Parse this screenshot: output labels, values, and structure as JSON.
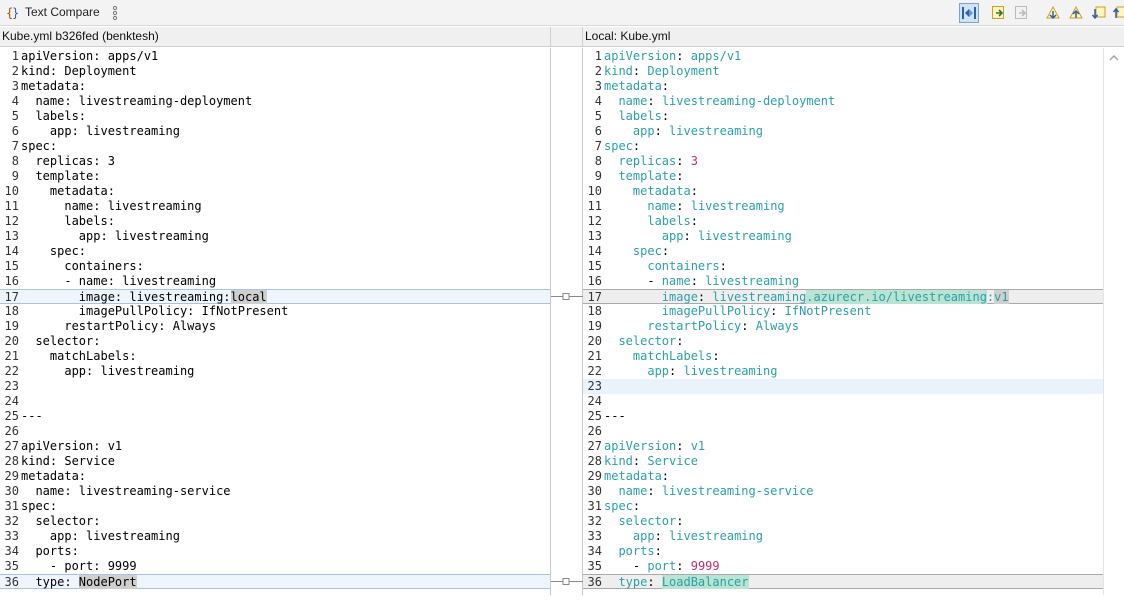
{
  "window": {
    "title": "Text Compare"
  },
  "toolbar": {
    "buttons": [
      {
        "name": "two-way-compare-button",
        "active": true
      },
      {
        "name": "copy-all-from-left-button"
      },
      {
        "name": "copy-current-change-button"
      },
      {
        "name": "next-difference-button"
      },
      {
        "name": "previous-difference-button"
      },
      {
        "name": "next-change-button"
      },
      {
        "name": "previous-change-button"
      }
    ]
  },
  "left": {
    "header": "Kube.yml b326fed (benktesh)",
    "lines": [
      "apiVersion: apps/v1",
      "kind: Deployment",
      "metadata:",
      "  name: livestreaming-deployment",
      "  labels:",
      "    app: livestreaming",
      "spec:",
      "  replicas: 3",
      "  template:",
      "    metadata:",
      "      name: livestreaming",
      "      labels:",
      "        app: livestreaming",
      "    spec:",
      "      containers:",
      "      - name: livestreaming",
      "        image: livestreaming:local",
      "        imagePullPolicy: IfNotPresent",
      "      restartPolicy: Always",
      "  selector:",
      "    matchLabels:",
      "      app: livestreaming",
      "",
      "",
      "---",
      "",
      "apiVersion: v1",
      "kind: Service",
      "metadata:",
      "  name: livestreaming-service",
      "spec:",
      "  selector:",
      "    app: livestreaming",
      "  ports:",
      "    - port: 9999",
      "  type: NodePort"
    ]
  },
  "right": {
    "header": "Local: Kube.yml",
    "lines": [
      "apiVersion: apps/v1",
      "kind: Deployment",
      "metadata:",
      "  name: livestreaming-deployment",
      "  labels:",
      "    app: livestreaming",
      "spec:",
      "  replicas: 3",
      "  template:",
      "    metadata:",
      "      name: livestreaming",
      "      labels:",
      "        app: livestreaming",
      "    spec:",
      "      containers:",
      "      - name: livestreaming",
      "        image: livestreaming.azurecr.io/livestreaming:v1",
      "        imagePullPolicy: IfNotPresent",
      "      restartPolicy: Always",
      "  selector:",
      "    matchLabels:",
      "      app: livestreaming",
      "",
      "",
      "---",
      "",
      "apiVersion: v1",
      "kind: Service",
      "metadata:",
      "  name: livestreaming-service",
      "spec:",
      "  selector:",
      "    app: livestreaming",
      "  ports:",
      "    - port: 9999",
      "  type: LoadBalancer"
    ]
  },
  "diff_lines": [
    17,
    36
  ],
  "cursor_line": 23
}
